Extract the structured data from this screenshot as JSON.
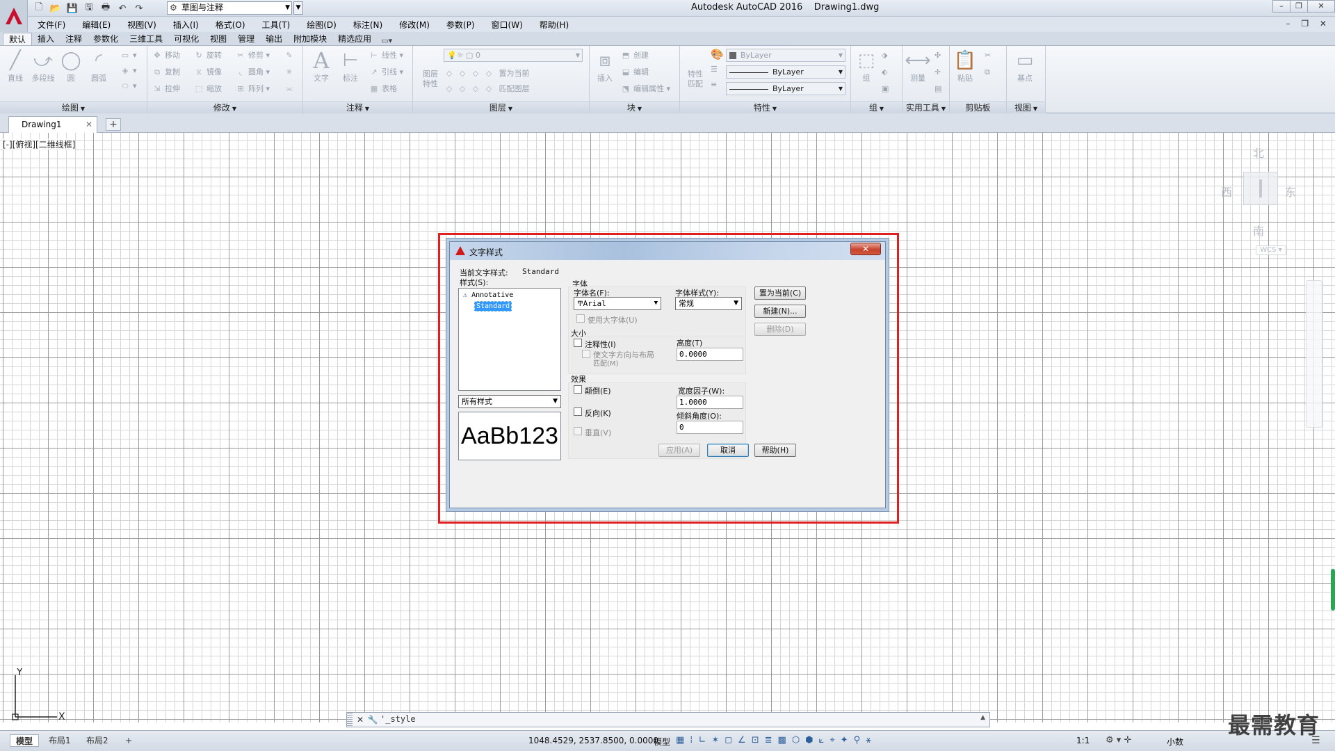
{
  "app": {
    "title": "Autodesk AutoCAD 2016    Drawing1.dwg",
    "workspace": "草图与注释"
  },
  "menu": [
    "文件(F)",
    "编辑(E)",
    "视图(V)",
    "插入(I)",
    "格式(O)",
    "工具(T)",
    "绘图(D)",
    "标注(N)",
    "修改(M)",
    "参数(P)",
    "窗口(W)",
    "帮助(H)"
  ],
  "ribbon_tabs": [
    "默认",
    "插入",
    "注释",
    "参数化",
    "三维工具",
    "可视化",
    "视图",
    "管理",
    "输出",
    "附加模块",
    "精选应用"
  ],
  "ribbon": {
    "draw": {
      "title": "绘图",
      "tools": [
        "直线",
        "多段线",
        "圆",
        "圆弧"
      ]
    },
    "modify": {
      "title": "修改",
      "tools": [
        "移动",
        "旋转",
        "修剪",
        "复制",
        "镜像",
        "圆角",
        "拉伸",
        "缩放",
        "阵列"
      ]
    },
    "annotate": {
      "title": "注释",
      "tools": [
        "文字",
        "标注",
        "线性",
        "引线",
        "表格"
      ]
    },
    "layers": {
      "title": "图层",
      "big": "图层特性",
      "current": "0",
      "set_current": "置为当前",
      "match": "匹配图层"
    },
    "block": {
      "title": "块",
      "insert": "插入",
      "create": "创建",
      "edit": "编辑",
      "edit_attr": "编辑属性"
    },
    "properties": {
      "title": "特性",
      "match": "特性匹配",
      "color": "ByLayer",
      "linetype": "ByLayer",
      "lineweight": "ByLayer"
    },
    "groups": {
      "title": "组",
      "group": "组"
    },
    "utilities": {
      "title": "实用工具",
      "measure": "测量"
    },
    "clipboard": {
      "title": "剪贴板",
      "paste": "粘贴"
    },
    "view": {
      "title": "视图",
      "base": "基点"
    }
  },
  "document": {
    "tab": "Drawing1",
    "viewport_label": "[-][俯视][二维线框]"
  },
  "viewcube": {
    "north": "北",
    "south": "南",
    "east": "东",
    "west": "西",
    "wcs": "WCS"
  },
  "ucs": {
    "y": "Y",
    "x": "X"
  },
  "dialog": {
    "title": "文字样式",
    "current_style_label": "当前文字样式:",
    "current_style": "Standard",
    "styles_label": "样式(S):",
    "styles": [
      "Annotative",
      "Standard"
    ],
    "filter": "所有样式",
    "preview": "AaBb123",
    "font_group": "字体",
    "font_name_label": "字体名(F):",
    "font_name": "Arial",
    "font_style_label": "字体样式(Y):",
    "font_style": "常规",
    "big_font": "使用大字体(U)",
    "size_group": "大小",
    "annotative": "注释性(I)",
    "match_layout_1": "使文字方向与布局",
    "match_layout_2": "匹配(M)",
    "height_label": "高度(T)",
    "height": "0.0000",
    "effects_group": "效果",
    "upside_down": "颠倒(E)",
    "backwards": "反向(K)",
    "vertical": "垂直(V)",
    "width_factor_label": "宽度因子(W):",
    "width_factor": "1.0000",
    "oblique_label": "倾斜角度(O):",
    "oblique": "0",
    "set_current": "置为当前(C)",
    "new": "新建(N)...",
    "delete": "删除(D)",
    "apply": "应用(A)",
    "cancel": "取消",
    "help": "帮助(H)"
  },
  "command": {
    "text": "'_style"
  },
  "status": {
    "layouts": [
      "模型",
      "布局1",
      "布局2"
    ],
    "coords": "1048.4529, 2537.8500, 0.0000",
    "model": "模型",
    "scale": "1:1",
    "units": "小数"
  },
  "watermark": "最需教育",
  "colors": {
    "highlight": "#e02020",
    "selection": "#3399ff",
    "app_red": "#d11a1a"
  }
}
